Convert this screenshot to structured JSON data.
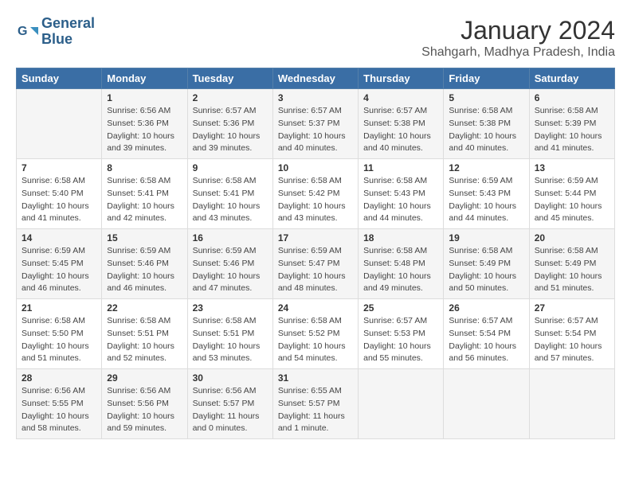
{
  "header": {
    "logo_line1": "General",
    "logo_line2": "Blue",
    "month": "January 2024",
    "location": "Shahgarh, Madhya Pradesh, India"
  },
  "days_of_week": [
    "Sunday",
    "Monday",
    "Tuesday",
    "Wednesday",
    "Thursday",
    "Friday",
    "Saturday"
  ],
  "weeks": [
    [
      {
        "day": "",
        "info": ""
      },
      {
        "day": "1",
        "info": "Sunrise: 6:56 AM\nSunset: 5:36 PM\nDaylight: 10 hours\nand 39 minutes."
      },
      {
        "day": "2",
        "info": "Sunrise: 6:57 AM\nSunset: 5:36 PM\nDaylight: 10 hours\nand 39 minutes."
      },
      {
        "day": "3",
        "info": "Sunrise: 6:57 AM\nSunset: 5:37 PM\nDaylight: 10 hours\nand 40 minutes."
      },
      {
        "day": "4",
        "info": "Sunrise: 6:57 AM\nSunset: 5:38 PM\nDaylight: 10 hours\nand 40 minutes."
      },
      {
        "day": "5",
        "info": "Sunrise: 6:58 AM\nSunset: 5:38 PM\nDaylight: 10 hours\nand 40 minutes."
      },
      {
        "day": "6",
        "info": "Sunrise: 6:58 AM\nSunset: 5:39 PM\nDaylight: 10 hours\nand 41 minutes."
      }
    ],
    [
      {
        "day": "7",
        "info": "Sunrise: 6:58 AM\nSunset: 5:40 PM\nDaylight: 10 hours\nand 41 minutes."
      },
      {
        "day": "8",
        "info": "Sunrise: 6:58 AM\nSunset: 5:41 PM\nDaylight: 10 hours\nand 42 minutes."
      },
      {
        "day": "9",
        "info": "Sunrise: 6:58 AM\nSunset: 5:41 PM\nDaylight: 10 hours\nand 43 minutes."
      },
      {
        "day": "10",
        "info": "Sunrise: 6:58 AM\nSunset: 5:42 PM\nDaylight: 10 hours\nand 43 minutes."
      },
      {
        "day": "11",
        "info": "Sunrise: 6:58 AM\nSunset: 5:43 PM\nDaylight: 10 hours\nand 44 minutes."
      },
      {
        "day": "12",
        "info": "Sunrise: 6:59 AM\nSunset: 5:43 PM\nDaylight: 10 hours\nand 44 minutes."
      },
      {
        "day": "13",
        "info": "Sunrise: 6:59 AM\nSunset: 5:44 PM\nDaylight: 10 hours\nand 45 minutes."
      }
    ],
    [
      {
        "day": "14",
        "info": "Sunrise: 6:59 AM\nSunset: 5:45 PM\nDaylight: 10 hours\nand 46 minutes."
      },
      {
        "day": "15",
        "info": "Sunrise: 6:59 AM\nSunset: 5:46 PM\nDaylight: 10 hours\nand 46 minutes."
      },
      {
        "day": "16",
        "info": "Sunrise: 6:59 AM\nSunset: 5:46 PM\nDaylight: 10 hours\nand 47 minutes."
      },
      {
        "day": "17",
        "info": "Sunrise: 6:59 AM\nSunset: 5:47 PM\nDaylight: 10 hours\nand 48 minutes."
      },
      {
        "day": "18",
        "info": "Sunrise: 6:58 AM\nSunset: 5:48 PM\nDaylight: 10 hours\nand 49 minutes."
      },
      {
        "day": "19",
        "info": "Sunrise: 6:58 AM\nSunset: 5:49 PM\nDaylight: 10 hours\nand 50 minutes."
      },
      {
        "day": "20",
        "info": "Sunrise: 6:58 AM\nSunset: 5:49 PM\nDaylight: 10 hours\nand 51 minutes."
      }
    ],
    [
      {
        "day": "21",
        "info": "Sunrise: 6:58 AM\nSunset: 5:50 PM\nDaylight: 10 hours\nand 51 minutes."
      },
      {
        "day": "22",
        "info": "Sunrise: 6:58 AM\nSunset: 5:51 PM\nDaylight: 10 hours\nand 52 minutes."
      },
      {
        "day": "23",
        "info": "Sunrise: 6:58 AM\nSunset: 5:51 PM\nDaylight: 10 hours\nand 53 minutes."
      },
      {
        "day": "24",
        "info": "Sunrise: 6:58 AM\nSunset: 5:52 PM\nDaylight: 10 hours\nand 54 minutes."
      },
      {
        "day": "25",
        "info": "Sunrise: 6:57 AM\nSunset: 5:53 PM\nDaylight: 10 hours\nand 55 minutes."
      },
      {
        "day": "26",
        "info": "Sunrise: 6:57 AM\nSunset: 5:54 PM\nDaylight: 10 hours\nand 56 minutes."
      },
      {
        "day": "27",
        "info": "Sunrise: 6:57 AM\nSunset: 5:54 PM\nDaylight: 10 hours\nand 57 minutes."
      }
    ],
    [
      {
        "day": "28",
        "info": "Sunrise: 6:56 AM\nSunset: 5:55 PM\nDaylight: 10 hours\nand 58 minutes."
      },
      {
        "day": "29",
        "info": "Sunrise: 6:56 AM\nSunset: 5:56 PM\nDaylight: 10 hours\nand 59 minutes."
      },
      {
        "day": "30",
        "info": "Sunrise: 6:56 AM\nSunset: 5:57 PM\nDaylight: 11 hours\nand 0 minutes."
      },
      {
        "day": "31",
        "info": "Sunrise: 6:55 AM\nSunset: 5:57 PM\nDaylight: 11 hours\nand 1 minute."
      },
      {
        "day": "",
        "info": ""
      },
      {
        "day": "",
        "info": ""
      },
      {
        "day": "",
        "info": ""
      }
    ]
  ]
}
